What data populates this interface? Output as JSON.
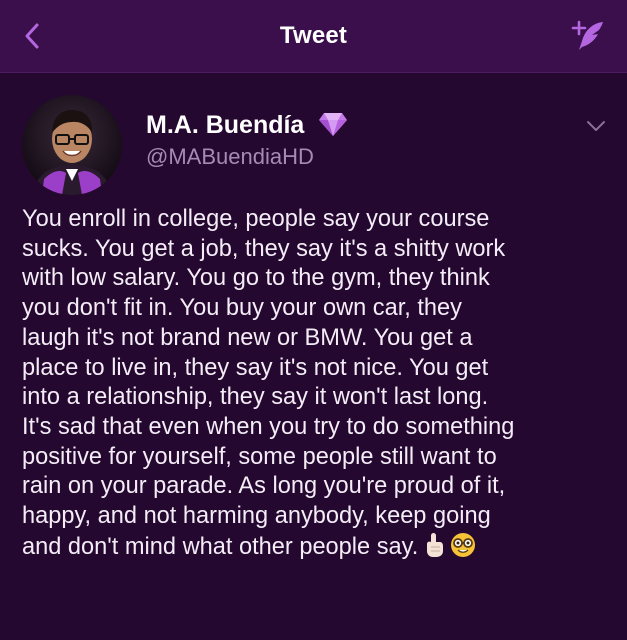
{
  "navbar": {
    "title": "Tweet",
    "back_icon": "chevron-left-icon",
    "compose_icon": "compose-tweet-icon",
    "accent_color": "#b467e0"
  },
  "tweet": {
    "author_name": "M.A. Buendía",
    "handle": "@MABuendiaHD",
    "verified_icon": "gem-icon",
    "menu_icon": "chevron-down-icon",
    "text_lines": [
      "You enroll in college, people say your course",
      "sucks. You get a job, they say it's a shitty work",
      "with low salary. You go to the gym, they think",
      "you don't fit in. You buy your own car, they",
      "laugh it's not brand new or BMW. You get a",
      "place to live in, they say it's not nice. You get",
      "into a relationship, they say it won't last long.",
      "It's sad that even when you try to do something",
      "positive for yourself, some people still want to",
      "rain on your parade. As long you're proud of it,",
      "happy, and not harming anybody, keep going",
      "and don't mind what other people say."
    ],
    "emojis": [
      "index-pointing-up-icon",
      "nerd-face-icon"
    ]
  },
  "colors": {
    "background": "#23072f",
    "navbar": "#3a0f4b",
    "text": "#f4ecf6",
    "handle": "#a68ab4"
  }
}
